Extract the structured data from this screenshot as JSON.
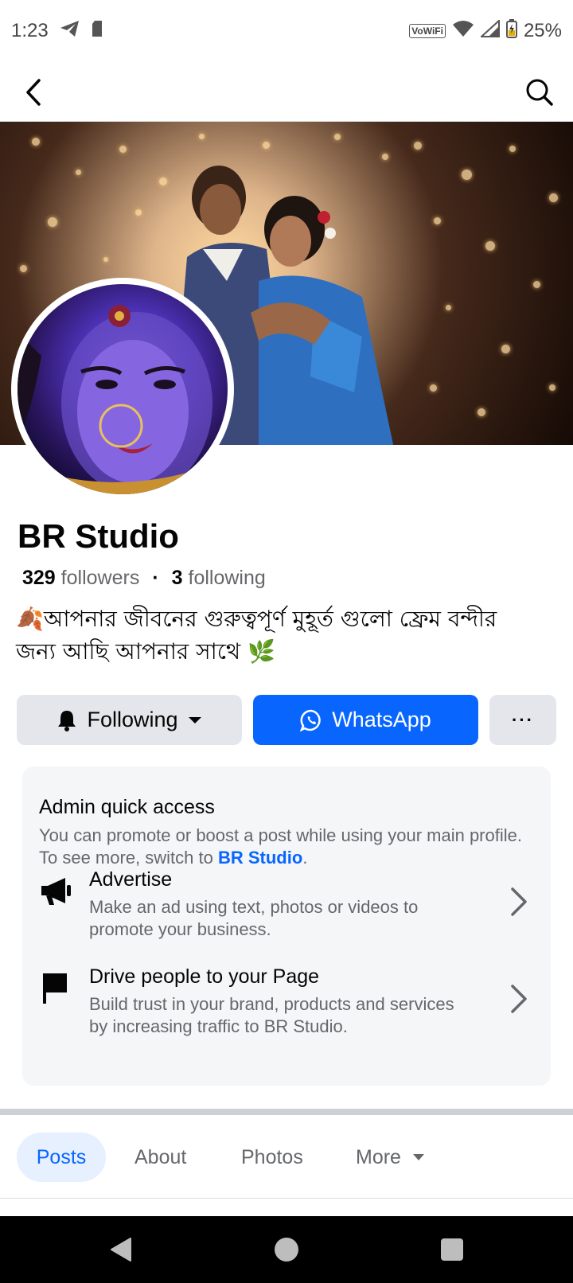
{
  "status_bar": {
    "time": "1:23",
    "vowifi": "VoWiFi",
    "battery": "25%"
  },
  "header": {
    "back_icon": "chevron-left-icon",
    "search_icon": "search-icon"
  },
  "profile": {
    "name": "BR Studio",
    "followers_count": "329",
    "followers_label": "followers",
    "separator": "·",
    "following_count": "3",
    "following_label": "following",
    "bio_line1": "🍂আপনার জীবনের গুরুত্বপূর্ণ মুহূর্ত গুলো ফ্রেম বন্দীর",
    "bio_line2": "জন্য আছি আপনার সাথে 🌿"
  },
  "actions": {
    "following_label": "Following",
    "whatsapp_label": "WhatsApp",
    "more_label": "···"
  },
  "admin": {
    "title": "Admin quick access",
    "desc_prefix": "You can promote or boost a post while using your main profile. To see more, switch to ",
    "desc_link": "BR Studio",
    "desc_suffix": ".",
    "items": [
      {
        "title": "Advertise",
        "desc": "Make an ad using text, photos or videos to promote your business.",
        "icon": "megaphone-icon"
      },
      {
        "title": "Drive people to your Page",
        "desc": "Build trust in your brand, products and services by increasing traffic to BR Studio.",
        "icon": "flag-icon"
      }
    ]
  },
  "tabs": [
    {
      "label": "Posts",
      "active": true
    },
    {
      "label": "About",
      "active": false
    },
    {
      "label": "Photos",
      "active": false
    },
    {
      "label": "More",
      "active": false
    }
  ],
  "colors": {
    "accent": "#0866ff",
    "button_gray": "#e4e6eb",
    "secondary_text": "#65676b",
    "card_bg": "#f5f6f8"
  }
}
